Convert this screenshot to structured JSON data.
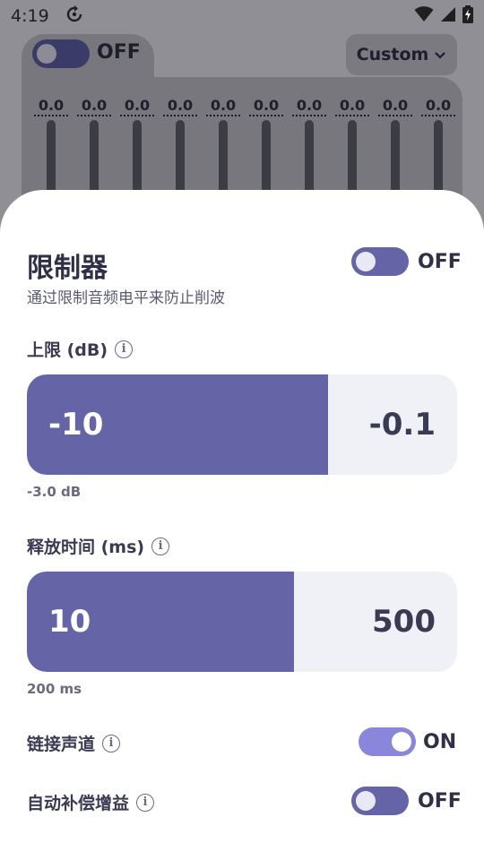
{
  "status_bar": {
    "time": "4:19",
    "sync_icon": "sync-icon",
    "wifi_icon": "wifi-icon",
    "signal_icon": "signal-icon",
    "battery_icon": "battery-charging-icon"
  },
  "equalizer": {
    "toggle_state": "OFF",
    "preset_label": "Custom",
    "bands": [
      "0.0",
      "0.0",
      "0.0",
      "0.0",
      "0.0",
      "0.0",
      "0.0",
      "0.0",
      "0.0",
      "0.0"
    ]
  },
  "limiter_sheet": {
    "title": "限制器",
    "subtitle": "通过限制音频电平来防止削波",
    "main_toggle_state": "OFF",
    "ceiling": {
      "label": "上限 (dB)",
      "min": "-10",
      "max": "-0.1",
      "current": "-3.0 dB",
      "fill_fraction": 0.7
    },
    "release": {
      "label": "释放时间 (ms)",
      "min": "10",
      "max": "500",
      "current": "200 ms",
      "fill_fraction": 0.62
    },
    "link_channels": {
      "label": "链接声道",
      "state": "ON"
    },
    "auto_makeup_gain": {
      "label": "自动补偿增益",
      "state": "OFF"
    }
  },
  "colors": {
    "accent": "#6464a6",
    "toggle_on": "#8a86dc",
    "slider_track": "#f0f0f7"
  }
}
